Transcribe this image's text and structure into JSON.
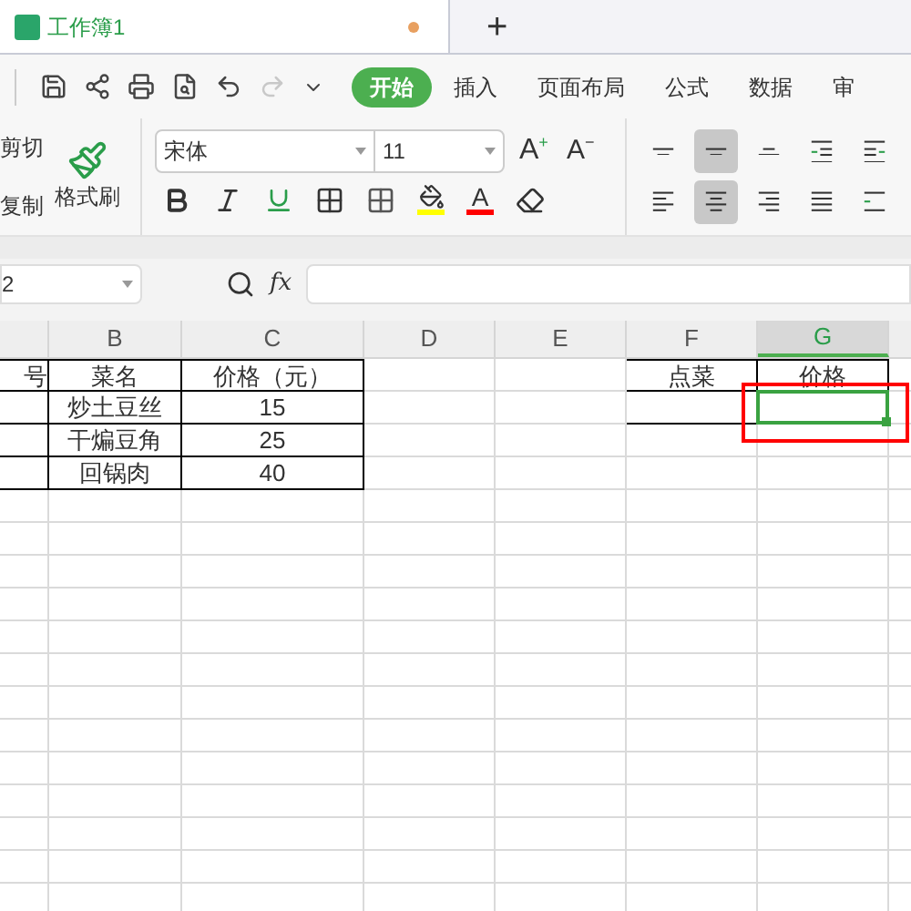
{
  "tabs": [
    {
      "label": "工作簿1",
      "selected": true,
      "unsaved": true
    }
  ],
  "new_tab": "+",
  "quick_access": [
    {
      "kind": "save",
      "disabled": false
    },
    {
      "kind": "share",
      "disabled": false
    },
    {
      "kind": "print",
      "disabled": false
    },
    {
      "kind": "preview",
      "disabled": false
    },
    {
      "kind": "undo",
      "disabled": false
    },
    {
      "kind": "redo",
      "disabled": true
    },
    {
      "kind": "more",
      "disabled": false
    }
  ],
  "menu": [
    {
      "label": "开始",
      "selected": true
    },
    {
      "label": "插入",
      "selected": false
    },
    {
      "label": "页面布局",
      "selected": false
    },
    {
      "label": "公式",
      "selected": false
    },
    {
      "label": "数据",
      "selected": false
    },
    {
      "label": "审",
      "selected": false
    }
  ],
  "clipboard": {
    "cut": "剪切",
    "copy": "复制",
    "format_painter": "格式刷"
  },
  "font": {
    "name": "宋体",
    "size": "11",
    "grow": "A",
    "grow_sign": "+",
    "shrink": "A",
    "shrink_sign": "−"
  },
  "format_buttons": [
    {
      "kind": "bold"
    },
    {
      "kind": "italic"
    },
    {
      "kind": "underline"
    },
    {
      "kind": "borders"
    },
    {
      "kind": "conditional"
    },
    {
      "kind": "fill",
      "color": "#ffff00"
    },
    {
      "kind": "font-color",
      "label": "A",
      "color": "#ff0000"
    },
    {
      "kind": "eraser"
    }
  ],
  "alignment": [
    {
      "kind": "top",
      "selected": false
    },
    {
      "kind": "middle",
      "selected": true
    },
    {
      "kind": "bottom",
      "selected": false
    },
    {
      "kind": "outdent",
      "selected": false
    },
    {
      "kind": "indent",
      "selected": false
    },
    {
      "kind": "left",
      "selected": false
    },
    {
      "kind": "center",
      "selected": true
    },
    {
      "kind": "right",
      "selected": false
    },
    {
      "kind": "justify",
      "selected": false
    },
    {
      "kind": "distributed",
      "selected": false
    }
  ],
  "name_box": "2",
  "fx": "fx",
  "columns": [
    {
      "label": "B",
      "selected": false
    },
    {
      "label": "C",
      "selected": false
    },
    {
      "label": "D",
      "selected": false
    },
    {
      "label": "E",
      "selected": false
    },
    {
      "label": "F",
      "selected": false
    },
    {
      "label": "G",
      "selected": true
    }
  ],
  "rows": [
    [
      {
        "text": "号",
        "border": true
      },
      {
        "text": "菜名",
        "border": true
      },
      {
        "text": "价格（元）",
        "border": true
      },
      {},
      {},
      {
        "text": "点菜",
        "border": true
      },
      {
        "text": "价格",
        "border": true
      }
    ],
    [
      {
        "border": true
      },
      {
        "text": "炒土豆丝",
        "border": true
      },
      {
        "text": "15",
        "border": true
      },
      {},
      {},
      {
        "border": true
      },
      {
        "border": true,
        "selected": true
      }
    ],
    [
      {
        "border": true
      },
      {
        "text": "干煸豆角",
        "border": true
      },
      {
        "text": "25",
        "border": true
      },
      {},
      {},
      {},
      {}
    ],
    [
      {
        "border": true
      },
      {
        "text": "回锅肉",
        "border": true
      },
      {
        "text": "40",
        "border": true
      },
      {},
      {},
      {},
      {}
    ]
  ],
  "highlight": {
    "on": true
  }
}
